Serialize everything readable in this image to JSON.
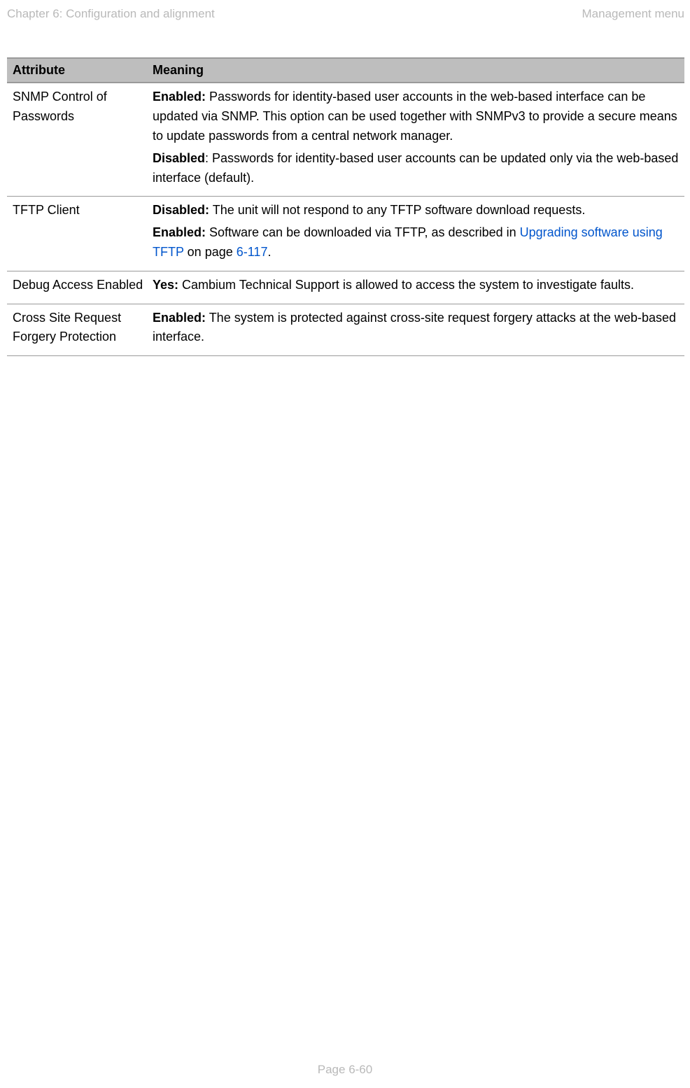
{
  "header": {
    "left": "Chapter 6:  Configuration and alignment",
    "right": "Management menu"
  },
  "table": {
    "columns": {
      "attribute": "Attribute",
      "meaning": "Meaning"
    },
    "rows": [
      {
        "attribute": "SNMP Control of Passwords",
        "p1_label": "Enabled:",
        "p1_text": " Passwords for identity-based user accounts in the web-based interface can be updated via SNMP. This option can be used together with SNMPv3 to provide a secure means to update passwords from a central network manager.",
        "p2_label": "Disabled",
        "p2_text": ": Passwords for identity-based user accounts can be updated only via the web-based interface (default)."
      },
      {
        "attribute": "TFTP Client",
        "p1_label": "Disabled:",
        "p1_text": " The unit will not respond to any TFTP software download requests.",
        "p2_label": "Enabled:",
        "p2_text_pre": " Software can be downloaded via TFTP, as described in ",
        "p2_link": "Upgrading software using TFTP",
        "p2_text_mid": " on page ",
        "p2_pageref": "6-117",
        "p2_text_post": "."
      },
      {
        "attribute": "Debug Access Enabled",
        "p1_label": "Yes:",
        "p1_text": " Cambium Technical Support is allowed to access the system to investigate faults."
      },
      {
        "attribute": "Cross Site Request Forgery Protection",
        "p1_label": "Enabled:",
        "p1_text": " The system is protected against cross-site request forgery attacks at the web-based interface."
      }
    ]
  },
  "footer": {
    "page": "Page 6-60"
  }
}
